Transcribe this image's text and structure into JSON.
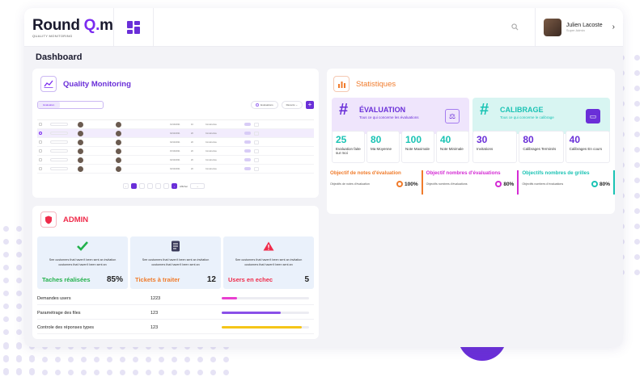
{
  "brand": {
    "logo_main": "Round ",
    "logo_q": "Q.",
    "logo_end": "m",
    "tagline": "QUALITY MONITORING"
  },
  "header": {
    "user_name": "Julien Lacoste",
    "user_role": "Super Admin"
  },
  "page": {
    "title": "Dashboard"
  },
  "colors": {
    "accent": "#7b2bf0",
    "orange": "#f07b2b",
    "magenta": "#d42bd4",
    "teal": "#1ac3b4",
    "red": "#ef2b4a",
    "green": "#22b14c"
  },
  "quality_monitoring": {
    "title": "Quality Monitoring",
    "segments": [
      "Evaluation",
      "",
      ""
    ],
    "filter_label": "Evaluations",
    "sort_label": "Récents",
    "rows": [
      {
        "date": "01/10/2021",
        "num": "10",
        "eval": "Constructive"
      },
      {
        "date": "04/12/2021",
        "num": "20",
        "eval": "Constructive"
      },
      {
        "date": "04/12/2021",
        "num": "20",
        "eval": "Constructive"
      },
      {
        "date": "15/10/2021",
        "num": "20",
        "eval": "Constructive"
      },
      {
        "date": "04/12/2021",
        "num": "20",
        "eval": "Constructive"
      },
      {
        "date": "04/12/2021",
        "num": "20",
        "eval": "Constructive"
      }
    ],
    "pager_label": "Afficher"
  },
  "statistiques": {
    "title": "Statistiques",
    "evaluation": {
      "title": "ÉVALUATION",
      "subtitle": "Tous ce qui concerne les évaluations",
      "kpis": [
        {
          "value": "25",
          "label": "Evaluation faite sur moi"
        },
        {
          "value": "80",
          "label": "Ma Moyenne"
        },
        {
          "value": "100",
          "label": "Note Maximale"
        },
        {
          "value": "40",
          "label": "Note Minimale"
        }
      ]
    },
    "calibrage": {
      "title": "CALIBRAGE",
      "subtitle": "Tous ce qui concerne le calibrage",
      "kpis": [
        {
          "value": "30",
          "label": "Invitations"
        },
        {
          "value": "80",
          "label": "Calibrages Terminés"
        },
        {
          "value": "40",
          "label": "Calibrages En cours"
        }
      ]
    },
    "objectives": [
      {
        "title": "Objectif de notes d'évaluation",
        "sub": "Objectifs de notes d'évaluation",
        "value": "100%",
        "color": "#f07b2b"
      },
      {
        "title": "Objectif nombres d'évaluations",
        "sub": "Objectifs nombres d'évaluations",
        "value": "80%",
        "color": "#d42bd4"
      },
      {
        "title": "Objectifs nombres de grilles",
        "sub": "Objectifs nombres d'évaluations",
        "value": "80%",
        "color": "#1ac3b4"
      }
    ]
  },
  "admin": {
    "title": "ADMIN",
    "tiles": [
      {
        "desc": "See customers that haven't been sent an invitation customers that haven't been sent an",
        "label": "Taches réalisées",
        "value": "85%",
        "color": "#22b14c"
      },
      {
        "desc": "See customers that haven't been sent an invitation customers that haven't been sent an",
        "label": "Tickets à traiter",
        "value": "12",
        "color": "#f07b2b"
      },
      {
        "desc": "See customers that haven't been sent an invitation customers that haven't been sent an",
        "label": "Users en echec",
        "value": "5",
        "color": "#ef2b4a"
      }
    ],
    "rows": [
      {
        "label": "Demandes users",
        "value": "1223",
        "progress": 0.18,
        "color": "#e83fd0"
      },
      {
        "label": "Paramétrage des files",
        "value": "123",
        "progress": 0.68,
        "color": "#8a4fe8"
      },
      {
        "label": "Controle des réponses types",
        "value": "123",
        "progress": 0.92,
        "color": "#f5c518"
      }
    ]
  }
}
